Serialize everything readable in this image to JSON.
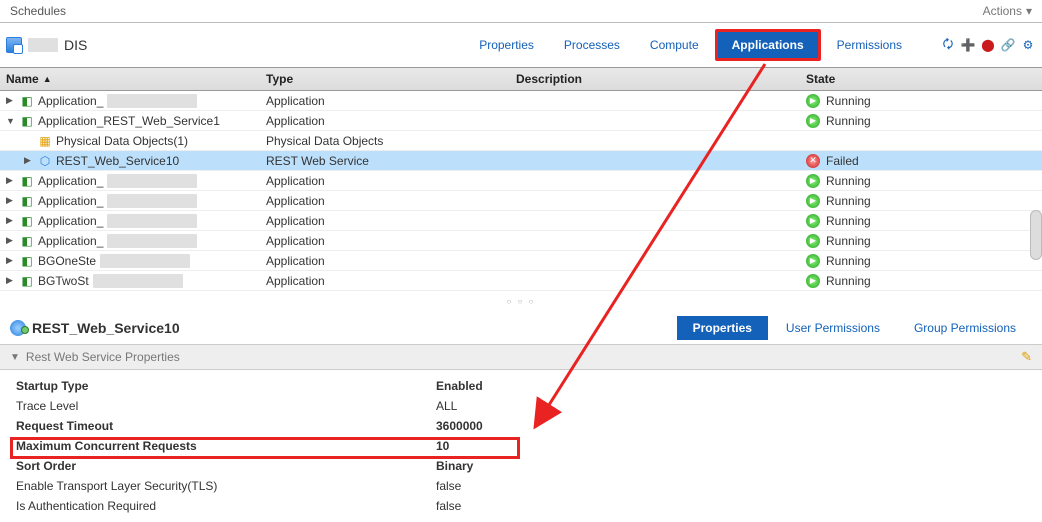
{
  "topbar": {
    "schedules": "Schedules",
    "actions": "Actions"
  },
  "header": {
    "title": "DIS"
  },
  "tabs": [
    {
      "label": "Properties",
      "active": false
    },
    {
      "label": "Processes",
      "active": false
    },
    {
      "label": "Compute",
      "active": false
    },
    {
      "label": "Applications",
      "active": true,
      "highlight": true
    },
    {
      "label": "Permissions",
      "active": false
    }
  ],
  "columns": {
    "name": "Name",
    "type": "Type",
    "description": "Description",
    "state": "State"
  },
  "rows": [
    {
      "twist": "▶",
      "indent": 0,
      "icon": "app",
      "nameMasked": true,
      "namePrefix": "Application_",
      "type": "Application",
      "state": "Running",
      "stateIcon": "run",
      "sel": false
    },
    {
      "twist": "▼",
      "indent": 0,
      "icon": "app",
      "nameMasked": false,
      "namePrefix": "Application_REST_Web_Service1",
      "type": "Application",
      "state": "Running",
      "stateIcon": "run",
      "sel": false
    },
    {
      "twist": "",
      "indent": 1,
      "icon": "folder",
      "nameMasked": false,
      "namePrefix": "Physical Data Objects(1)",
      "type": "Physical Data Objects",
      "state": "",
      "stateIcon": "",
      "sel": false
    },
    {
      "twist": "▶",
      "indent": 1,
      "icon": "svc",
      "nameMasked": false,
      "namePrefix": "REST_Web_Service10",
      "type": "REST Web Service",
      "state": "Failed",
      "stateIcon": "fail",
      "sel": true
    },
    {
      "twist": "▶",
      "indent": 0,
      "icon": "app",
      "nameMasked": true,
      "namePrefix": "Application_",
      "type": "Application",
      "state": "Running",
      "stateIcon": "run",
      "sel": false
    },
    {
      "twist": "▶",
      "indent": 0,
      "icon": "app",
      "nameMasked": true,
      "namePrefix": "Application_",
      "type": "Application",
      "state": "Running",
      "stateIcon": "run",
      "sel": false
    },
    {
      "twist": "▶",
      "indent": 0,
      "icon": "app",
      "nameMasked": true,
      "namePrefix": "Application_",
      "type": "Application",
      "state": "Running",
      "stateIcon": "run",
      "sel": false
    },
    {
      "twist": "▶",
      "indent": 0,
      "icon": "app",
      "nameMasked": true,
      "namePrefix": "Application_",
      "type": "Application",
      "state": "Running",
      "stateIcon": "run",
      "sel": false
    },
    {
      "twist": "▶",
      "indent": 0,
      "icon": "app",
      "nameMasked": true,
      "namePrefix": "BGOneSte",
      "type": "Application",
      "state": "Running",
      "stateIcon": "run",
      "sel": false
    },
    {
      "twist": "▶",
      "indent": 0,
      "icon": "app",
      "nameMasked": true,
      "namePrefix": "BGTwoSt",
      "type": "Application",
      "state": "Running",
      "stateIcon": "run",
      "sel": false
    }
  ],
  "detail": {
    "title": "REST_Web_Service10",
    "section": "Rest Web Service Properties",
    "tabs": [
      {
        "label": "Properties",
        "active": true
      },
      {
        "label": "User Permissions",
        "active": false
      },
      {
        "label": "Group Permissions",
        "active": false
      }
    ],
    "props": [
      {
        "label": "Startup Type",
        "value": "Enabled",
        "bold": true
      },
      {
        "label": "Trace Level",
        "value": "ALL",
        "bold": false
      },
      {
        "label": "Request Timeout",
        "value": "3600000",
        "bold": true
      },
      {
        "label": "Maximum Concurrent Requests",
        "value": "10",
        "bold": true
      },
      {
        "label": "Sort Order",
        "value": "Binary",
        "bold": true
      },
      {
        "label": "Enable Transport Layer Security(TLS)",
        "value": "false",
        "bold": false
      },
      {
        "label": "Is Authentication Required",
        "value": "false",
        "bold": false
      }
    ]
  }
}
